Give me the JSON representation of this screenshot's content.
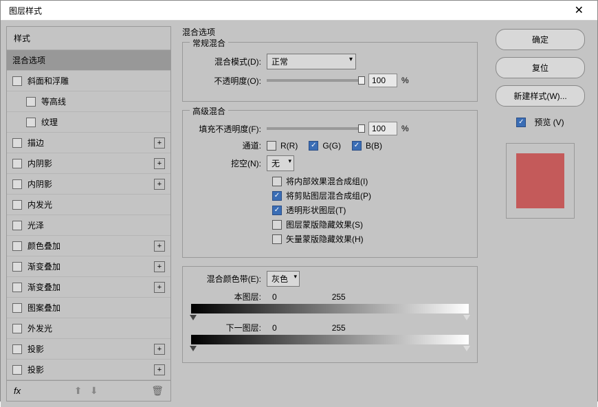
{
  "titlebar": {
    "title": "图层样式"
  },
  "left": {
    "header": "样式",
    "items": [
      {
        "label": "混合选项",
        "selected": true,
        "indent": false,
        "chk": false,
        "plus": false
      },
      {
        "label": "斜面和浮雕",
        "indent": false,
        "chk": true,
        "plus": false
      },
      {
        "label": "等高线",
        "indent": true,
        "chk": true,
        "plus": false
      },
      {
        "label": "纹理",
        "indent": true,
        "chk": true,
        "plus": false
      },
      {
        "label": "描边",
        "indent": false,
        "chk": true,
        "plus": true
      },
      {
        "label": "内阴影",
        "indent": false,
        "chk": true,
        "plus": true
      },
      {
        "label": "内阴影",
        "indent": false,
        "chk": true,
        "plus": true
      },
      {
        "label": "内发光",
        "indent": false,
        "chk": true,
        "plus": false
      },
      {
        "label": "光泽",
        "indent": false,
        "chk": true,
        "plus": false
      },
      {
        "label": "颜色叠加",
        "indent": false,
        "chk": true,
        "plus": true
      },
      {
        "label": "渐变叠加",
        "indent": false,
        "chk": true,
        "plus": true
      },
      {
        "label": "渐变叠加",
        "indent": false,
        "chk": true,
        "plus": true
      },
      {
        "label": "图案叠加",
        "indent": false,
        "chk": true,
        "plus": false
      },
      {
        "label": "外发光",
        "indent": false,
        "chk": true,
        "plus": false
      },
      {
        "label": "投影",
        "indent": false,
        "chk": true,
        "plus": true
      },
      {
        "label": "投影",
        "indent": false,
        "chk": true,
        "plus": true
      }
    ],
    "fx": "fx"
  },
  "center": {
    "section_title": "混合选项",
    "general": {
      "legend": "常规混合",
      "mode_label": "混合模式(D):",
      "mode_value": "正常",
      "opacity_label": "不透明度(O):",
      "opacity_value": "100",
      "pct": "%"
    },
    "advanced": {
      "legend": "高级混合",
      "fill_label": "填充不透明度(F):",
      "fill_value": "100",
      "pct": "%",
      "channel_label": "通道:",
      "ch_r": "R(R)",
      "ch_g": "G(G)",
      "ch_b": "B(B)",
      "knockout_label": "挖空(N):",
      "knockout_value": "无",
      "opt1": "将内部效果混合成组(I)",
      "opt2": "将剪贴图层混合成组(P)",
      "opt3": "透明形状图层(T)",
      "opt4": "图层蒙版隐藏效果(S)",
      "opt5": "矢量蒙版隐藏效果(H)"
    },
    "blendif": {
      "label": "混合颜色带(E):",
      "value": "灰色",
      "this_label": "本图层:",
      "this_lo": "0",
      "this_hi": "255",
      "under_label": "下一图层:",
      "under_lo": "0",
      "under_hi": "255"
    }
  },
  "right": {
    "ok": "确定",
    "reset": "复位",
    "new_style": "新建样式(W)...",
    "preview": "预览 (V)"
  }
}
